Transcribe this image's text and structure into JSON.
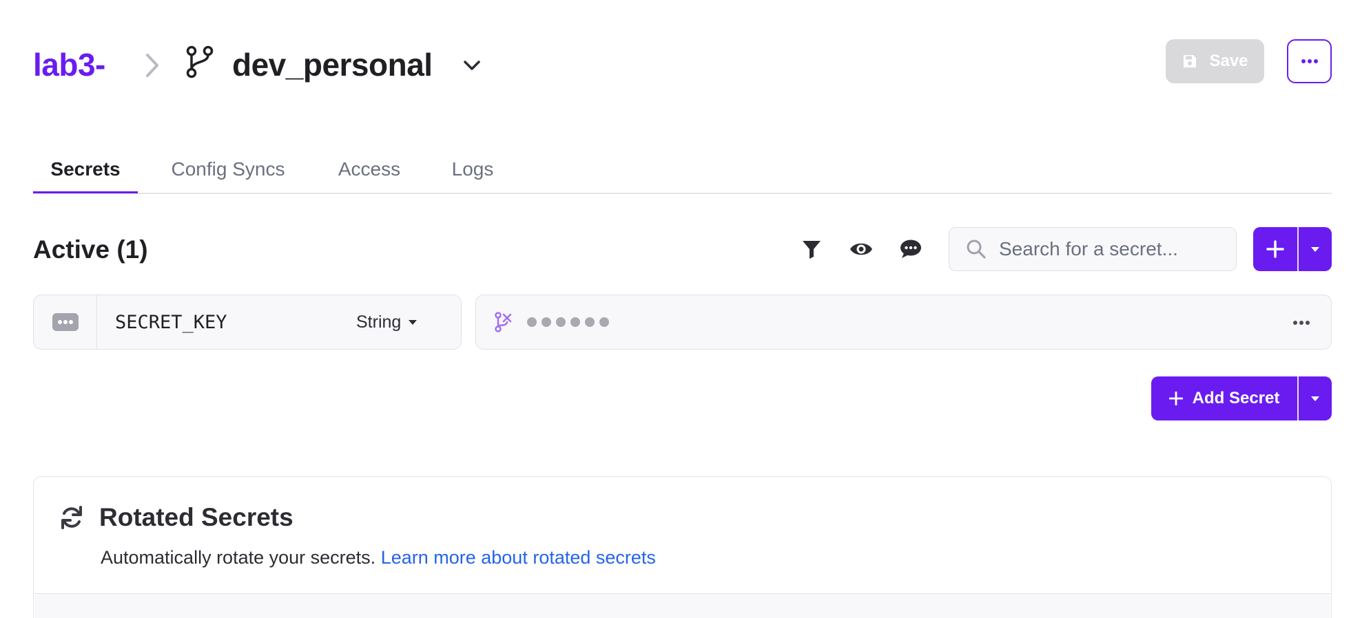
{
  "breadcrumb": {
    "project": "lab3-",
    "branch": "dev_personal"
  },
  "header": {
    "save_label": "Save"
  },
  "tabs": [
    {
      "label": "Secrets",
      "active": true
    },
    {
      "label": "Config Syncs",
      "active": false
    },
    {
      "label": "Access",
      "active": false
    },
    {
      "label": "Logs",
      "active": false
    }
  ],
  "active_section": {
    "heading": "Active (1)",
    "search_placeholder": "Search for a secret..."
  },
  "secrets": [
    {
      "key": "SECRET_KEY",
      "type": "String",
      "masked": true
    }
  ],
  "add_secret_label": "Add Secret",
  "rotated": {
    "title": "Rotated Secrets",
    "description": "Automatically rotate your secrets.",
    "link": "Learn more about rotated secrets"
  },
  "colors": {
    "accent": "#6a1cf0",
    "link": "#2563eb",
    "disabled": "#d9d9dc"
  },
  "icons": {
    "branch": "git-branch-icon",
    "filter": "filter-icon",
    "visibility": "eye-icon",
    "comments": "comment-icon",
    "search": "search-icon",
    "add": "plus-icon",
    "more": "ellipsis-icon",
    "rotate": "refresh-icon",
    "save": "floppy-icon",
    "override": "branch-override-icon"
  }
}
